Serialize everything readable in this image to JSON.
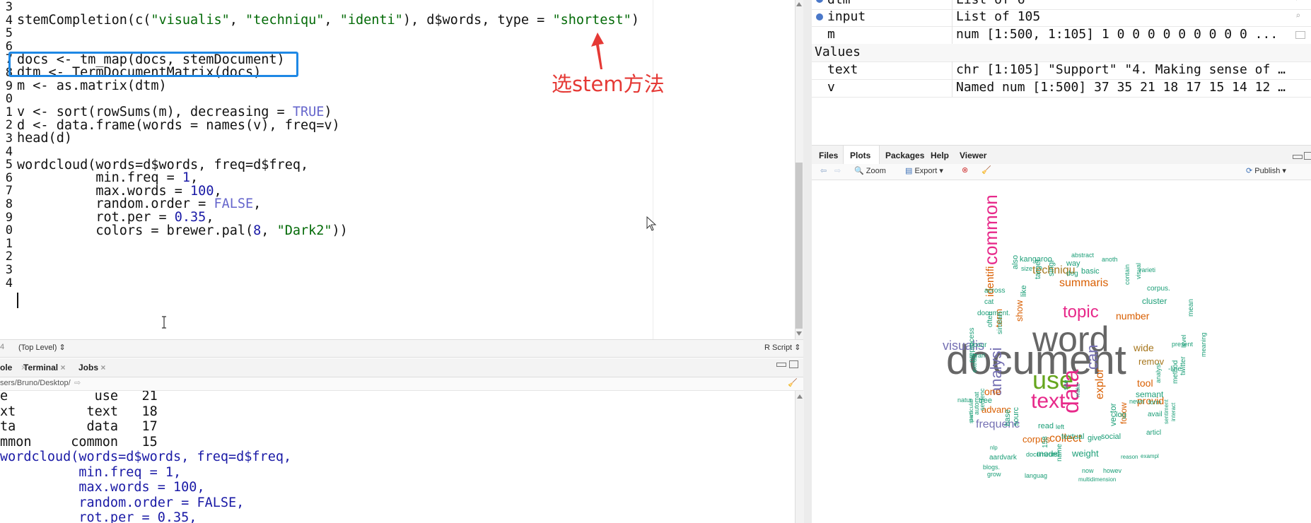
{
  "editor": {
    "gutter": [
      "3",
      "4",
      "5",
      "6",
      "7",
      "8",
      "9",
      "0",
      "1",
      "2",
      "3",
      "4",
      "5",
      "6",
      "7",
      "8",
      "9",
      "0",
      "1",
      "2",
      "3",
      "4"
    ],
    "lines": [
      {
        "parts": [
          {
            "t": "stemCompletion(c(",
            "c": ""
          },
          {
            "t": "\"visualis\"",
            "c": "s"
          },
          {
            "t": ", ",
            "c": ""
          },
          {
            "t": "\"techniqu\"",
            "c": "s"
          },
          {
            "t": ", ",
            "c": ""
          },
          {
            "t": "\"identi\"",
            "c": "s"
          },
          {
            "t": "), d$words, type = ",
            "c": ""
          },
          {
            "t": "\"shortest\"",
            "c": "s"
          },
          {
            "t": ")",
            "c": ""
          }
        ]
      },
      {
        "parts": []
      },
      {
        "parts": []
      },
      {
        "parts": [
          {
            "t": "docs <- tm_map(docs, stemDocument)",
            "c": ""
          }
        ]
      },
      {
        "parts": [
          {
            "t": "dtm <- TermDocumentMatrix(docs)",
            "c": ""
          }
        ]
      },
      {
        "parts": [
          {
            "t": "m <- as.matrix(dtm)",
            "c": ""
          }
        ]
      },
      {
        "parts": []
      },
      {
        "parts": [
          {
            "t": "v <- sort(rowSums(m), decreasing = ",
            "c": ""
          },
          {
            "t": "TRUE",
            "c": "c"
          },
          {
            "t": ")",
            "c": ""
          }
        ]
      },
      {
        "parts": [
          {
            "t": "d <- data.frame(words = names(v), freq=v)",
            "c": ""
          }
        ]
      },
      {
        "parts": [
          {
            "t": "head(d)",
            "c": ""
          }
        ]
      },
      {
        "parts": []
      },
      {
        "parts": [
          {
            "t": "wordcloud(words=d$words, freq=d$freq,",
            "c": ""
          }
        ]
      },
      {
        "parts": [
          {
            "t": "          min.freq = ",
            "c": ""
          },
          {
            "t": "1",
            "c": "k"
          },
          {
            "t": ",",
            "c": ""
          }
        ]
      },
      {
        "parts": [
          {
            "t": "          max.words = ",
            "c": ""
          },
          {
            "t": "100",
            "c": "k"
          },
          {
            "t": ",",
            "c": ""
          }
        ]
      },
      {
        "parts": [
          {
            "t": "          random.order = ",
            "c": ""
          },
          {
            "t": "FALSE",
            "c": "c"
          },
          {
            "t": ",",
            "c": ""
          }
        ]
      },
      {
        "parts": [
          {
            "t": "          rot.per = ",
            "c": ""
          },
          {
            "t": "0.35",
            "c": "k"
          },
          {
            "t": ",",
            "c": ""
          }
        ]
      },
      {
        "parts": [
          {
            "t": "          colors = brewer.pal(",
            "c": ""
          },
          {
            "t": "8",
            "c": "k"
          },
          {
            "t": ", ",
            "c": ""
          },
          {
            "t": "\"Dark2\"",
            "c": "s"
          },
          {
            "t": "))",
            "c": ""
          }
        ]
      },
      {
        "parts": []
      },
      {
        "parts": []
      },
      {
        "parts": []
      },
      {
        "parts": []
      },
      {
        "parts": []
      }
    ],
    "annotation": "选stem方法",
    "status_left": "(Top Level)",
    "status_right": "R Script"
  },
  "console": {
    "tabs": [
      "ole",
      "Terminal",
      "Jobs"
    ],
    "path": "sers/Bruno/Desktop/",
    "lines": [
      {
        "t": "e           use   21",
        "c": ""
      },
      {
        "t": "xt         text   18",
        "c": ""
      },
      {
        "t": "ta         data   17",
        "c": ""
      },
      {
        "t": "mmon     common   15",
        "c": ""
      },
      {
        "t": "wordcloud(words=d$words, freq=d$freq,",
        "c": "b"
      },
      {
        "t": "          min.freq = 1,",
        "c": "b"
      },
      {
        "t": "          max.words = 100,",
        "c": "b"
      },
      {
        "t": "          random.order = FALSE,",
        "c": "b"
      },
      {
        "t": "          rot.per = 0.35,",
        "c": "b"
      }
    ]
  },
  "environment": {
    "rows": [
      {
        "name": "dtm",
        "value": "List of 6",
        "expand": true
      },
      {
        "name": "input",
        "value": "List of 105",
        "expand": true
      },
      {
        "name": "m",
        "value": "num [1:500, 1:105] 1 0 0 0 0 0 0 0 0 0 ...",
        "expand": false
      }
    ],
    "values_header": "Values",
    "values": [
      {
        "name": "text",
        "value": "chr [1:105] \"Support\" \"4. Making sense of …"
      },
      {
        "name": "v",
        "value": "Named num [1:500] 37 35 21 18 17 15 14 12 …"
      }
    ]
  },
  "plots_pane": {
    "tabs": [
      "Files",
      "Plots",
      "Packages",
      "Help",
      "Viewer"
    ],
    "active_tab": "Plots",
    "zoom_label": "Zoom",
    "export_label": "Export",
    "publish_label": "Publish"
  },
  "wordcloud": {
    "colors": {
      "purple": "#7570b3",
      "pink": "#e7298a",
      "green": "#66a61e",
      "gold": "#e6ab02",
      "brown": "#a6761d",
      "orange": "#d95f02",
      "teal": "#1b9e77",
      "gray": "#666666"
    },
    "words": [
      {
        "w": "document",
        "size": 58,
        "color": "gray",
        "rot": 0
      },
      {
        "w": "word",
        "size": 50,
        "color": "gray",
        "rot": 0
      },
      {
        "w": "use",
        "size": 36,
        "color": "green",
        "rot": 0
      },
      {
        "w": "text",
        "size": 30,
        "color": "pink",
        "rot": 0
      },
      {
        "w": "data",
        "size": 32,
        "color": "pink",
        "rot": -90
      },
      {
        "w": "common",
        "size": 26,
        "color": "pink",
        "rot": -90
      },
      {
        "w": "topic",
        "size": 24,
        "color": "pink",
        "rot": 0
      },
      {
        "w": "analysi",
        "size": 22,
        "color": "purple",
        "rot": -90
      },
      {
        "w": "can",
        "size": 22,
        "color": "purple",
        "rot": -90
      },
      {
        "w": "visualis",
        "size": 18,
        "color": "purple",
        "rot": 0
      },
      {
        "w": "summaris",
        "size": 16,
        "color": "orange",
        "rot": 0
      },
      {
        "w": "techniqu",
        "size": 16,
        "color": "brown",
        "rot": 0
      },
      {
        "w": "frequenc",
        "size": 16,
        "color": "purple",
        "rot": 0
      },
      {
        "w": "collect",
        "size": 16,
        "color": "orange",
        "rot": 0
      },
      {
        "w": "explor",
        "size": 16,
        "color": "orange",
        "rot": -90
      },
      {
        "w": "identifi",
        "size": 15,
        "color": "orange",
        "rot": -90
      },
      {
        "w": "number",
        "size": 14,
        "color": "orange",
        "rot": 0
      },
      {
        "w": "wide",
        "size": 14,
        "color": "brown",
        "rot": 0
      },
      {
        "w": "remov",
        "size": 13,
        "color": "brown",
        "rot": 0
      },
      {
        "w": "tool",
        "size": 14,
        "color": "orange",
        "rot": 0
      },
      {
        "w": "provid",
        "size": 14,
        "color": "orange",
        "rot": 0
      },
      {
        "w": "one",
        "size": 14,
        "color": "orange",
        "rot": 0
      },
      {
        "w": "advanc",
        "size": 13,
        "color": "orange",
        "rot": 0
      },
      {
        "w": "corpus",
        "size": 13,
        "color": "orange",
        "rot": 0
      },
      {
        "w": "weight",
        "size": 13,
        "color": "teal",
        "rot": 0
      },
      {
        "w": "show",
        "size": 13,
        "color": "orange",
        "rot": -90
      },
      {
        "w": "term",
        "size": 13,
        "color": "orange",
        "rot": -90
      },
      {
        "w": "cluster",
        "size": 12,
        "color": "teal",
        "rot": 0
      },
      {
        "w": "semant",
        "size": 12,
        "color": "teal",
        "rot": 0
      },
      {
        "w": "model",
        "size": 12,
        "color": "teal",
        "rot": 0
      },
      {
        "w": "follow",
        "size": 12,
        "color": "orange",
        "rot": -90
      },
      {
        "w": "vector",
        "size": 12,
        "color": "teal",
        "rot": -90
      },
      {
        "w": "textual",
        "size": 11,
        "color": "teal",
        "rot": 0
      },
      {
        "w": "give",
        "size": 11,
        "color": "teal",
        "rot": 0
      },
      {
        "w": "social",
        "size": 11,
        "color": "teal",
        "rot": 0
      },
      {
        "w": "read",
        "size": 11,
        "color": "teal",
        "rot": 0
      },
      {
        "w": "log",
        "size": 11,
        "color": "teal",
        "rot": 0
      },
      {
        "w": "basic",
        "size": 11,
        "color": "teal",
        "rot": 0
      },
      {
        "w": "like",
        "size": 11,
        "color": "teal",
        "rot": -90
      },
      {
        "w": "target",
        "size": 11,
        "color": "teal",
        "rot": -90
      },
      {
        "w": "also",
        "size": 11,
        "color": "teal",
        "rot": -90
      },
      {
        "w": "singl",
        "size": 11,
        "color": "teal",
        "rot": -90
      },
      {
        "w": "kangaroo",
        "size": 11,
        "color": "teal",
        "rot": 0
      },
      {
        "w": "way",
        "size": 11,
        "color": "teal",
        "rot": 0
      },
      {
        "w": "dog",
        "size": 10,
        "color": "teal",
        "rot": 0
      },
      {
        "w": "size",
        "size": 9,
        "color": "teal",
        "rot": 0
      },
      {
        "w": "abstract",
        "size": 9,
        "color": "teal",
        "rot": 0
      },
      {
        "w": "anoth",
        "size": 9,
        "color": "teal",
        "rot": 0
      },
      {
        "w": "contain",
        "size": 9,
        "color": "teal",
        "rot": -90
      },
      {
        "w": "varieti",
        "size": 9,
        "color": "teal",
        "rot": 0
      },
      {
        "w": "visual",
        "size": 9,
        "color": "teal",
        "rot": -90
      },
      {
        "w": "corpus.",
        "size": 10,
        "color": "teal",
        "rot": 0
      },
      {
        "w": "across",
        "size": 10,
        "color": "teal",
        "rot": 0
      },
      {
        "w": "cat",
        "size": 10,
        "color": "teal",
        "rot": 0
      },
      {
        "w": "document.",
        "size": 10,
        "color": "teal",
        "rot": 0
      },
      {
        "w": "similar",
        "size": 10,
        "color": "teal",
        "rot": -90
      },
      {
        "w": "often",
        "size": 10,
        "color": "teal",
        "rot": -90
      },
      {
        "w": "mean",
        "size": 10,
        "color": "teal",
        "rot": -90
      },
      {
        "w": "occur",
        "size": 10,
        "color": "teal",
        "rot": 0
      },
      {
        "w": "present",
        "size": 9,
        "color": "teal",
        "rot": 0
      },
      {
        "w": "librari",
        "size": 9,
        "color": "teal",
        "rot": 0
      },
      {
        "w": "-line",
        "size": 10,
        "color": "teal",
        "rot": 0
      },
      {
        "w": "level",
        "size": 9,
        "color": "teal",
        "rot": -90
      },
      {
        "w": "method",
        "size": 10,
        "color": "teal",
        "rot": -90
      },
      {
        "w": "meaning",
        "size": 9,
        "color": "teal",
        "rot": -90
      },
      {
        "w": "extract",
        "size": 9,
        "color": "teal",
        "rot": -90
      },
      {
        "w": "preprocess",
        "size": 10,
        "color": "teal",
        "rot": -90
      },
      {
        "w": "analysi",
        "size": 9,
        "color": "teal",
        "rot": -90
      },
      {
        "w": "twitter",
        "size": 10,
        "color": "teal",
        "rot": -90
      },
      {
        "w": "natur",
        "size": 9,
        "color": "teal",
        "rot": 0
      },
      {
        "w": "tree",
        "size": 11,
        "color": "teal",
        "rot": 0
      },
      {
        "w": "news",
        "size": 9,
        "color": "teal",
        "rot": 0
      },
      {
        "w": "form",
        "size": 9,
        "color": "teal",
        "rot": 0
      },
      {
        "w": "see",
        "size": 9,
        "color": "teal",
        "rot": -90
      },
      {
        "w": "make",
        "size": 8,
        "color": "teal",
        "rot": -90
      },
      {
        "w": "sentenc",
        "size": 9,
        "color": "teal",
        "rot": -90
      },
      {
        "w": "automat",
        "size": 9,
        "color": "teal",
        "rot": -90
      },
      {
        "w": "base",
        "size": 11,
        "color": "teal",
        "rot": -90
      },
      {
        "w": "sourc",
        "size": 11,
        "color": "teal",
        "rot": -90
      },
      {
        "w": "particular",
        "size": 8,
        "color": "teal",
        "rot": -90
      },
      {
        "w": "avail",
        "size": 10,
        "color": "teal",
        "rot": 0
      },
      {
        "w": "articl",
        "size": 10,
        "color": "teal",
        "rot": 0
      },
      {
        "w": "sentiment",
        "size": 8,
        "color": "teal",
        "rot": -90
      },
      {
        "w": "interact",
        "size": 8,
        "color": "teal",
        "rot": -90
      },
      {
        "w": "left",
        "size": 9,
        "color": "teal",
        "rot": 0
      },
      {
        "w": "stem",
        "size": 8,
        "color": "teal",
        "rot": -90
      },
      {
        "w": "nlp",
        "size": 8,
        "color": "teal",
        "rot": 0
      },
      {
        "w": "aardvark",
        "size": 10,
        "color": "teal",
        "rot": 0
      },
      {
        "w": "blogs.",
        "size": 9,
        "color": "teal",
        "rot": 0
      },
      {
        "w": "documents.",
        "size": 9,
        "color": "teal",
        "rot": 0
      },
      {
        "w": "grow",
        "size": 9,
        "color": "teal",
        "rot": 0
      },
      {
        "w": "languag",
        "size": 9,
        "color": "teal",
        "rot": 0
      },
      {
        "w": "158",
        "size": 10,
        "color": "teal",
        "rot": -90
      },
      {
        "w": "name",
        "size": 10,
        "color": "teal",
        "rot": -90
      },
      {
        "w": "now",
        "size": 9,
        "color": "teal",
        "rot": 0
      },
      {
        "w": "howev",
        "size": 9,
        "color": "teal",
        "rot": 0
      },
      {
        "w": "reason",
        "size": 8,
        "color": "teal",
        "rot": 0
      },
      {
        "w": "exampl",
        "size": 8,
        "color": "teal",
        "rot": 0
      },
      {
        "w": "multidimension",
        "size": 8,
        "color": "teal",
        "rot": 0
      }
    ]
  }
}
